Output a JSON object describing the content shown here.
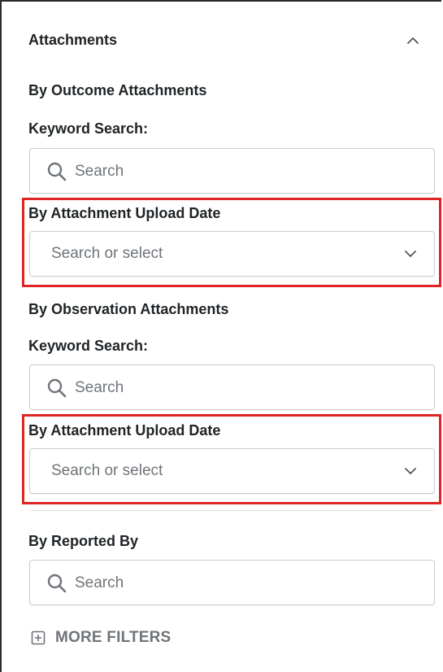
{
  "section": {
    "title": "Attachments"
  },
  "outcome": {
    "heading": "By Outcome Attachments",
    "keyword_label": "Keyword Search:",
    "search_placeholder": "Search",
    "date_label": "By Attachment Upload Date",
    "date_placeholder": "Search or select"
  },
  "observation": {
    "heading": "By Observation Attachments",
    "keyword_label": "Keyword Search:",
    "search_placeholder": "Search",
    "date_label": "By Attachment Upload Date",
    "date_placeholder": "Search or select"
  },
  "reported_by": {
    "label": "By Reported By",
    "search_placeholder": "Search"
  },
  "more_filters": {
    "label": "MORE FILTERS"
  },
  "colors": {
    "highlight": "#e02323",
    "text": "#1f2326",
    "placeholder": "#6f7479"
  },
  "icons": [
    "chevron-up-icon",
    "search-icon",
    "chevron-down-icon",
    "plus-square-icon"
  ]
}
